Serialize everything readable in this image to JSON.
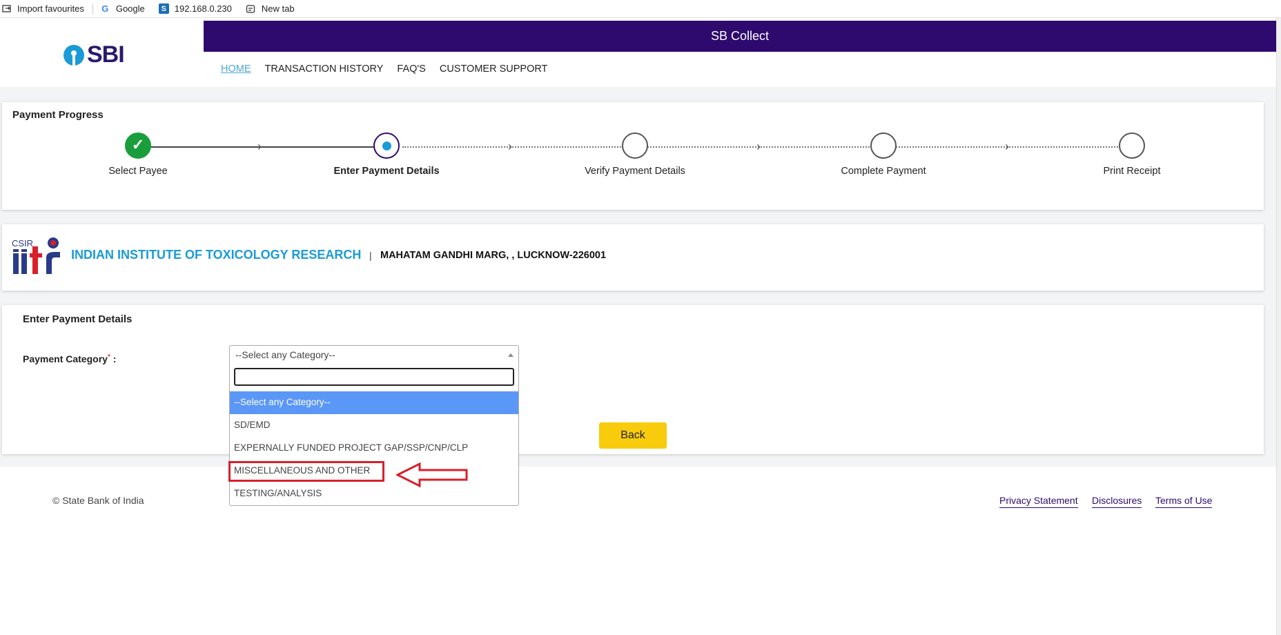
{
  "bookmarks": [
    {
      "label": "Import favourites",
      "icon": "import-icon"
    },
    {
      "label": "Google",
      "icon": "google-icon"
    },
    {
      "label": "192.168.0.230",
      "icon": "site-s-icon"
    },
    {
      "label": "New tab",
      "icon": "new-tab-icon"
    }
  ],
  "header": {
    "logo_text": "SBI",
    "app_title": "SB Collect",
    "nav": [
      "HOME",
      "TRANSACTION HISTORY",
      "FAQ'S",
      "CUSTOMER SUPPORT"
    ],
    "active_nav": "HOME"
  },
  "progress": {
    "title": "Payment Progress",
    "steps": [
      {
        "label": "Select Payee",
        "state": "done"
      },
      {
        "label": "Enter Payment Details",
        "state": "active"
      },
      {
        "label": "Verify Payment Details",
        "state": "pending"
      },
      {
        "label": "Complete Payment",
        "state": "pending"
      },
      {
        "label": "Print Receipt",
        "state": "pending"
      }
    ],
    "colors": {
      "done": "#1a9e3c",
      "active": "#1a9bd7"
    }
  },
  "institute": {
    "logo_text": "CSIR iitr",
    "name": "INDIAN INSTITUTE OF TOXICOLOGY RESEARCH",
    "separator": "|",
    "address": "MAHATAM GANDHI MARG, , LUCKNOW-226001"
  },
  "payment": {
    "title": "Enter Payment Details",
    "category_label": "Payment Category",
    "required_mark": "*",
    "colon": ":",
    "selected": "--Select any Category--",
    "search_value": "",
    "options": [
      "--Select any Category--",
      "SD/EMD",
      "EXPERNALLY FUNDED PROJECT GAP/SSP/CNP/CLP",
      "MISCELLANEOUS AND OTHER",
      "TESTING/ANALYSIS"
    ],
    "highlighted_option": "MISCELLANEOUS AND OTHER",
    "back_label": "Back"
  },
  "footer": {
    "copyright": "© State Bank of India",
    "links": [
      "Privacy Statement",
      "Disclosures",
      "Terms of Use"
    ]
  },
  "colors": {
    "brand_purple": "#2e0a6e",
    "brand_blue": "#1a9bd7",
    "button_yellow": "#f8cc0c",
    "annotation_red": "#d8202a"
  }
}
